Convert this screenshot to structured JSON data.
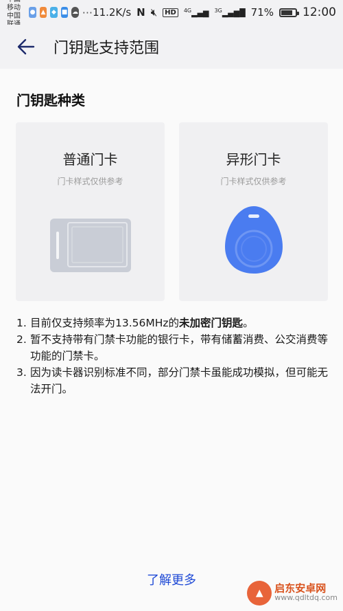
{
  "status_bar": {
    "carrier_1": "中国移动",
    "carrier_2": "中国联通",
    "speed": "11.2K/s",
    "network_1": "4G",
    "network_2": "3G",
    "battery": "71%",
    "time": "12:00"
  },
  "header": {
    "back_icon": "arrow-left-icon",
    "title": "门钥匙支持范围"
  },
  "main": {
    "section_title": "门钥匙种类",
    "cards": [
      {
        "title": "普通门卡",
        "note": "门卡样式仅供参考"
      },
      {
        "title": "异形门卡",
        "note": "门卡样式仅供参考"
      }
    ],
    "notes": [
      {
        "num": "1.",
        "text": "目前仅支持频率为13.56MHz的",
        "bold": "未加密门钥匙",
        "tail": "。"
      },
      {
        "num": "2.",
        "text": "暂不支持带有门禁卡功能的银行卡，带有储蓄消费、公交消费等功能的门禁卡。"
      },
      {
        "num": "3.",
        "text": "因为读卡器识别标准不同，部分门禁卡虽能成功模拟，但可能无法开门。"
      }
    ],
    "learn_more": "了解更多"
  },
  "watermark": {
    "name": "启东安卓网",
    "url": "www.qdltdq.com"
  },
  "colors": {
    "accent": "#1f4ad6",
    "card_bg": "#f0f0f2",
    "fob_blue": "#4a7cf0",
    "card_gray": "#c9cdd6"
  }
}
